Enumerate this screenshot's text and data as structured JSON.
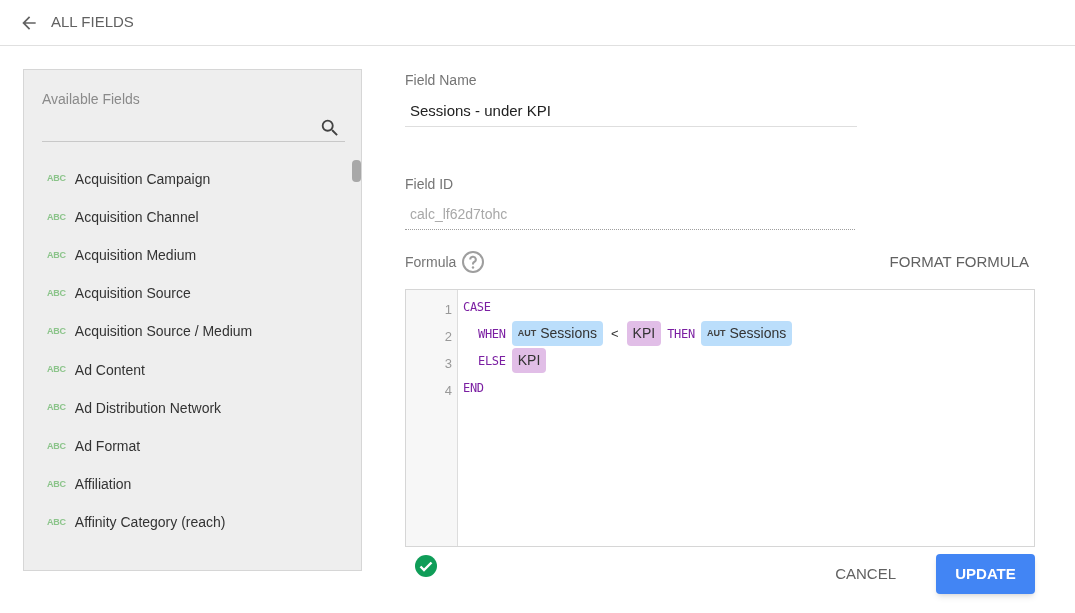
{
  "header": {
    "title": "ALL FIELDS"
  },
  "available_fields": {
    "label": "Available Fields",
    "items": [
      {
        "type": "ABC",
        "name": "Acquisition Campaign"
      },
      {
        "type": "ABC",
        "name": "Acquisition Channel"
      },
      {
        "type": "ABC",
        "name": "Acquisition Medium"
      },
      {
        "type": "ABC",
        "name": "Acquisition Source"
      },
      {
        "type": "ABC",
        "name": "Acquisition Source / Medium"
      },
      {
        "type": "ABC",
        "name": "Ad Content"
      },
      {
        "type": "ABC",
        "name": "Ad Distribution Network"
      },
      {
        "type": "ABC",
        "name": "Ad Format"
      },
      {
        "type": "ABC",
        "name": "Affiliation"
      },
      {
        "type": "ABC",
        "name": "Affinity Category (reach)"
      }
    ]
  },
  "field_name": {
    "label": "Field Name",
    "value": "Sessions - under KPI"
  },
  "field_id": {
    "label": "Field ID",
    "value": "calc_lf62d7tohc"
  },
  "formula": {
    "label": "Formula",
    "format_button": "FORMAT FORMULA",
    "lines": [
      {
        "number": "1",
        "indented": false,
        "tokens": [
          {
            "kind": "keyword",
            "text": "CASE"
          }
        ]
      },
      {
        "number": "2",
        "indented": true,
        "tokens": [
          {
            "kind": "keyword",
            "text": "WHEN"
          },
          {
            "kind": "field",
            "tag": "AUT",
            "text": "Sessions",
            "color": "#bbdefb"
          },
          {
            "kind": "operator",
            "text": "<"
          },
          {
            "kind": "field",
            "text": "KPI",
            "color": "#e1bee7"
          },
          {
            "kind": "keyword",
            "text": "THEN"
          },
          {
            "kind": "field",
            "tag": "AUT",
            "text": "Sessions",
            "color": "#bbdefb"
          }
        ]
      },
      {
        "number": "3",
        "indented": true,
        "tokens": [
          {
            "kind": "keyword",
            "text": "ELSE"
          },
          {
            "kind": "field",
            "text": "KPI",
            "color": "#e1bee7"
          }
        ]
      },
      {
        "number": "4",
        "indented": false,
        "tokens": [
          {
            "kind": "keyword",
            "text": "END"
          }
        ]
      }
    ],
    "valid": true
  },
  "buttons": {
    "cancel": "CANCEL",
    "update": "UPDATE"
  }
}
